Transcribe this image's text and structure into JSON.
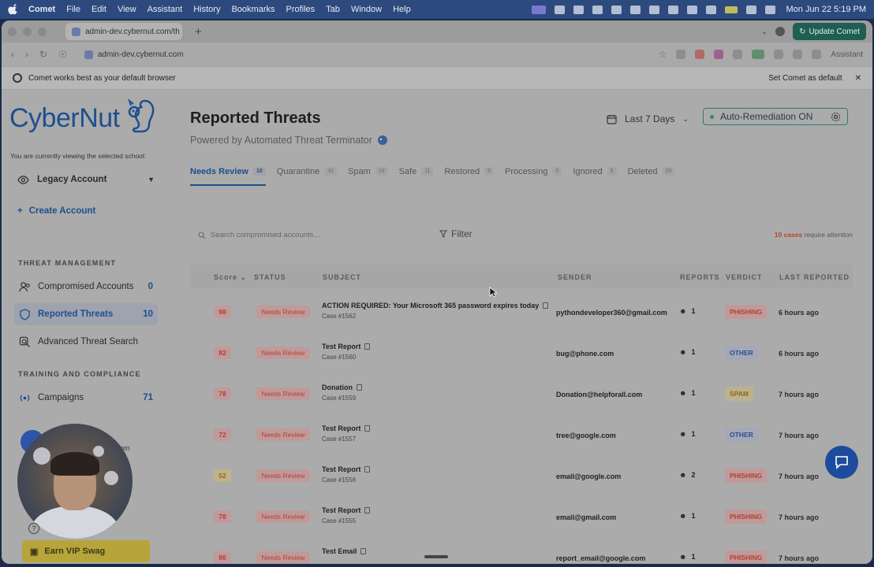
{
  "menubar": {
    "app": "Comet",
    "items": [
      "File",
      "Edit",
      "View",
      "Assistant",
      "History",
      "Bookmarks",
      "Profiles",
      "Tab",
      "Window",
      "Help"
    ],
    "clock": "Mon Jun 22  5:19 PM"
  },
  "browser": {
    "tab_title": "admin-dev.cybernut.com/th",
    "update_label": "Update Comet",
    "url": "admin-dev.cybernut.com",
    "assistant_label": "Assistant",
    "infobar_text": "Comet works best as your default browser",
    "set_default_label": "Set Comet as default"
  },
  "sidebar": {
    "brand": "CyberNut",
    "viewing_note": "You are currently viewing the selected school:",
    "account": "Legacy Account",
    "create_account": "Create Account",
    "section_threat": "THREAT MANAGEMENT",
    "items": [
      {
        "label": "Compromised Accounts",
        "count": "0"
      },
      {
        "label": "Reported Threats",
        "count": "10"
      },
      {
        "label": "Advanced Threat Search",
        "count": ""
      }
    ],
    "section_training": "TRAINING AND COMPLIANCE",
    "campaigns": {
      "label": "Campaigns",
      "count": "71"
    },
    "email_fragment": "om",
    "vip_label": "Earn VIP Swag"
  },
  "main": {
    "title": "Reported Threats",
    "subtitle": "Powered by Automated Threat Terminator",
    "date_range": "Last 7 Days",
    "auto_remediation": "Auto-Remediation ON",
    "tabs": [
      {
        "label": "Needs Review",
        "count": "10"
      },
      {
        "label": "Quarantine",
        "count": "31"
      },
      {
        "label": "Spam",
        "count": "16"
      },
      {
        "label": "Safe",
        "count": "11"
      },
      {
        "label": "Restored",
        "count": "5"
      },
      {
        "label": "Processing",
        "count": "0"
      },
      {
        "label": "Ignored",
        "count": "5"
      },
      {
        "label": "Deleted",
        "count": "20"
      }
    ],
    "search_placeholder": "Search compromised accounts...",
    "filter_label": "Filter",
    "attention_count": "10 cases",
    "attention_text": " require attention",
    "columns": {
      "score": "Score",
      "status": "STATUS",
      "subject": "SUBJECT",
      "sender": "SENDER",
      "reports": "REPORTS",
      "verdict": "VERDICT",
      "last_reported": "LAST REPORTED"
    },
    "rows": [
      {
        "score": "98",
        "status": "Needs Review",
        "subject": "ACTION REQUIRED: Your Microsoft 365 password expires today",
        "case": "Case #1562",
        "sender": "pythondeveloper360@gmail.com",
        "reports": "1",
        "verdict": "PHISHING",
        "last": "6 hours ago"
      },
      {
        "score": "82",
        "status": "Needs Review",
        "subject": "Test Report",
        "case": "Case #1560",
        "sender": "bug@phone.com",
        "reports": "1",
        "verdict": "OTHER",
        "last": "6 hours ago"
      },
      {
        "score": "78",
        "status": "Needs Review",
        "subject": "Donation",
        "case": "Case #1559",
        "sender": "Donation@helpforall.com",
        "reports": "1",
        "verdict": "SPAM",
        "last": "7 hours ago"
      },
      {
        "score": "72",
        "status": "Needs Review",
        "subject": "Test Report",
        "case": "Case #1557",
        "sender": "tree@google.com",
        "reports": "1",
        "verdict": "OTHER",
        "last": "7 hours ago"
      },
      {
        "score": "52",
        "status": "Needs Review",
        "subject": "Test Report",
        "case": "Case #1556",
        "sender": "email@google.com",
        "reports": "2",
        "verdict": "PHISHING",
        "last": "7 hours ago"
      },
      {
        "score": "78",
        "status": "Needs Review",
        "subject": "Test Report",
        "case": "Case #1555",
        "sender": "email@gmail.com",
        "reports": "1",
        "verdict": "PHISHING",
        "last": "7 hours ago"
      },
      {
        "score": "86",
        "status": "Needs Review",
        "subject": "Test Email",
        "case": "",
        "sender": "report_email@google.com",
        "reports": "1",
        "verdict": "PHISHING",
        "last": "7 hours ago"
      }
    ]
  },
  "colors": {
    "brand_blue": "#1d4f8f",
    "phishing_red": "#b3402f",
    "other_blue": "#2c4d8c",
    "spam_amber": "#8b6a1a"
  }
}
